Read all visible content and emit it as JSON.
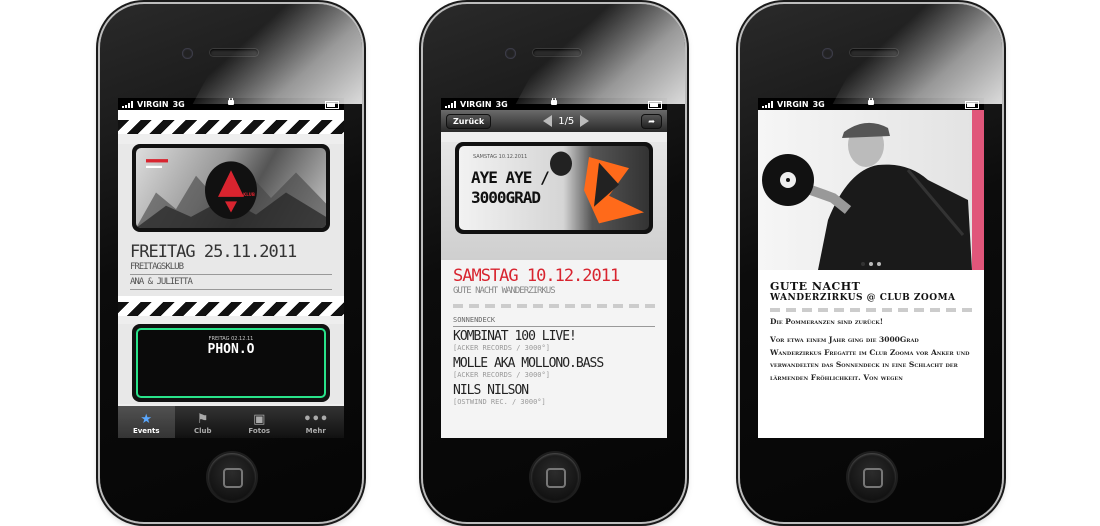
{
  "status": {
    "carrier": "VIRGIN",
    "network": "3G"
  },
  "phone1": {
    "flyer_tag": "FREITAGS KLUB",
    "event_date": "FREITAG 25.11.2011",
    "event_club": "FREITAGSKLUB",
    "event_artists": "ANA & JULIETTA",
    "flyer2_top": "FREITAG 02.12.11",
    "flyer2_title": "PHON.O",
    "tabs": [
      {
        "label": "Events",
        "icon": "star-icon"
      },
      {
        "label": "Club",
        "icon": "flag-icon"
      },
      {
        "label": "Fotos",
        "icon": "camera-icon"
      },
      {
        "label": "Mehr",
        "icon": "more-icon"
      }
    ]
  },
  "phone2": {
    "back": "Zurück",
    "page": "1/5",
    "flyer_top": "SAMSTAG 10.12.2011",
    "flyer_line1": "AYE AYE /",
    "flyer_line2": "3000GRAD",
    "event_date": "SAMSTAG 10.12.2011",
    "event_subtitle": "GUTE NACHT WANDERZIRKUS",
    "section": "SONNENDECK",
    "acts": [
      {
        "name": "KOMBINAT 100 LIVE!",
        "label": "[ACKER RECORDS / 3000°]"
      },
      {
        "name": "MOLLE AKA MOLLONO.BASS",
        "label": "[ACKER RECORDS / 3000°]"
      },
      {
        "name": "NILS NILSON",
        "label": "[OSTWIND REC. / 3000°]"
      }
    ]
  },
  "phone3": {
    "title1": "GUTE NACHT",
    "title2": "WANDERZIRKUS @ CLUB ZOOMA",
    "tagline": "Die Pommeranzen sind zurück!",
    "body": "Vor etwa einem Jahr ging die 3000Grad Wanderzirkus Fregatte im Club Zooma vor Anker und verwandelten das Sonnendeck in eine Schlacht der lärmenden Fröhlichkeit. Von wegen",
    "dots": 3
  },
  "colors": {
    "accent_red": "#d8242f",
    "accent_green": "#29e38a",
    "accent_orange": "#ff6a1a",
    "pink": "#e0567a"
  }
}
